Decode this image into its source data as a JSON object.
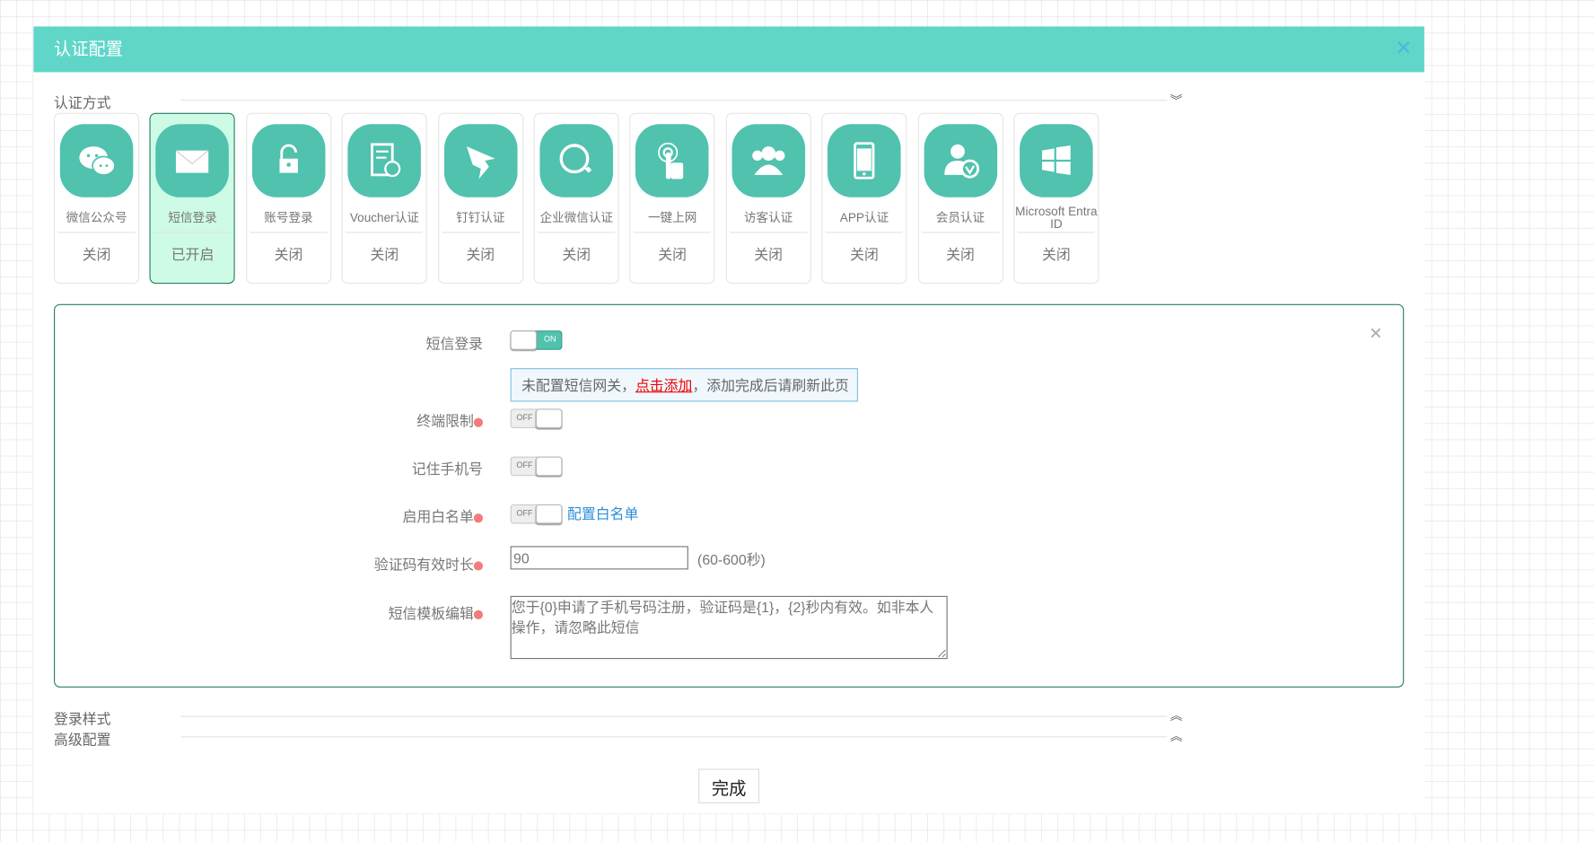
{
  "dialog": {
    "title": "认证配置",
    "close_icon": "close-icon"
  },
  "sections": {
    "auth_methods": "认证方式",
    "login_style": "登录样式",
    "advanced": "高级配置"
  },
  "methods": [
    {
      "name": "微信公众号",
      "status": "关闭",
      "icon": "wechat-icon"
    },
    {
      "name": "短信登录",
      "status": "已开启",
      "icon": "envelope-icon",
      "active": true
    },
    {
      "name": "账号登录",
      "status": "关闭",
      "icon": "lock-icon"
    },
    {
      "name": "Voucher认证",
      "status": "关闭",
      "icon": "voucher-icon"
    },
    {
      "name": "钉钉认证",
      "status": "关闭",
      "icon": "dingtalk-icon"
    },
    {
      "name": "企业微信认证",
      "status": "关闭",
      "icon": "wecom-icon"
    },
    {
      "name": "一键上网",
      "status": "关闭",
      "icon": "tap-icon"
    },
    {
      "name": "访客认证",
      "status": "关闭",
      "icon": "visitors-icon"
    },
    {
      "name": "APP认证",
      "status": "关闭",
      "icon": "phone-icon"
    },
    {
      "name": "会员认证",
      "status": "关闭",
      "icon": "member-icon"
    },
    {
      "name": "Microsoft Entra ID",
      "status": "关闭",
      "icon": "windows-icon"
    }
  ],
  "sms": {
    "sms_login_label": "短信登录",
    "sms_login_toggle": "ON",
    "notice_prefix": "未配置短信网关，",
    "notice_link": "点击添加",
    "notice_suffix": "，添加完成后请刷新此页",
    "terminal_limit_label": "终端限制",
    "terminal_limit_toggle": "OFF",
    "remember_phone_label": "记住手机号",
    "remember_phone_toggle": "OFF",
    "whitelist_label": "启用白名单",
    "whitelist_toggle": "OFF",
    "whitelist_link": "配置白名单",
    "code_validity_label": "验证码有效时长",
    "code_validity_value": "90",
    "code_validity_hint": "(60-600秒)",
    "template_label": "短信模板编辑",
    "template_value": "您于{0}申请了手机号码注册，验证码是{1}，{2}秒内有效。如非本人操作，请忽略此短信"
  },
  "footer": {
    "done_label": "完成"
  },
  "colors": {
    "header": "#5fd6c8",
    "icon_bg": "#50c2ae",
    "active_card": "#cdfbe6",
    "link": "#2a8fd8",
    "alert": "#e00000"
  }
}
